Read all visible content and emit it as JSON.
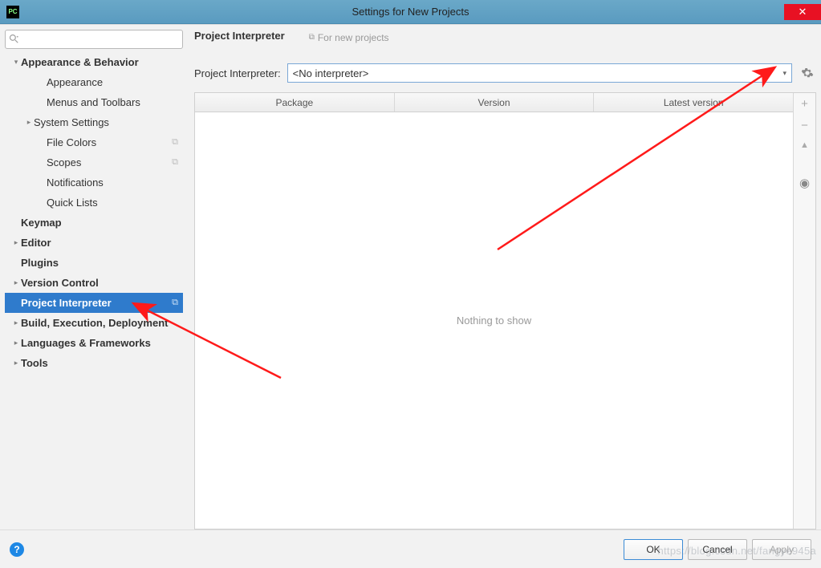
{
  "window": {
    "title": "Settings for New Projects",
    "close_glyph": "✕"
  },
  "sidebar": {
    "search_placeholder": "",
    "items": [
      {
        "label": "Appearance & Behavior",
        "indent": 0,
        "arrow": "v",
        "bold": true
      },
      {
        "label": "Appearance",
        "indent": 2,
        "arrow": ""
      },
      {
        "label": "Menus and Toolbars",
        "indent": 2,
        "arrow": ""
      },
      {
        "label": "System Settings",
        "indent": 1,
        "arrow": ">"
      },
      {
        "label": "File Colors",
        "indent": 2,
        "arrow": "",
        "copy": true
      },
      {
        "label": "Scopes",
        "indent": 2,
        "arrow": "",
        "copy": true
      },
      {
        "label": "Notifications",
        "indent": 2,
        "arrow": ""
      },
      {
        "label": "Quick Lists",
        "indent": 2,
        "arrow": ""
      },
      {
        "label": "Keymap",
        "indent": 0,
        "arrow": "",
        "bold": true
      },
      {
        "label": "Editor",
        "indent": 0,
        "arrow": ">",
        "bold": true
      },
      {
        "label": "Plugins",
        "indent": 0,
        "arrow": "",
        "bold": true
      },
      {
        "label": "Version Control",
        "indent": 0,
        "arrow": ">",
        "bold": true
      },
      {
        "label": "Project Interpreter",
        "indent": 0,
        "arrow": "",
        "bold": true,
        "selected": true,
        "copy": true
      },
      {
        "label": "Build, Execution, Deployment",
        "indent": 0,
        "arrow": ">",
        "bold": true
      },
      {
        "label": "Languages & Frameworks",
        "indent": 0,
        "arrow": ">",
        "bold": true
      },
      {
        "label": "Tools",
        "indent": 0,
        "arrow": ">",
        "bold": true
      }
    ]
  },
  "main": {
    "title": "Project Interpreter",
    "subtitle": "For new projects",
    "interpreter_label": "Project Interpreter:",
    "interpreter_value": "<No interpreter>",
    "columns": [
      "Package",
      "Version",
      "Latest version"
    ],
    "empty_text": "Nothing to show",
    "tool_add": "+",
    "tool_remove": "−",
    "tool_up": "▲",
    "tool_eye": "◉"
  },
  "footer": {
    "ok": "OK",
    "cancel": "Cancel",
    "apply": "Apply"
  },
  "watermark": "https://blog.csdn.net/fangye945a"
}
